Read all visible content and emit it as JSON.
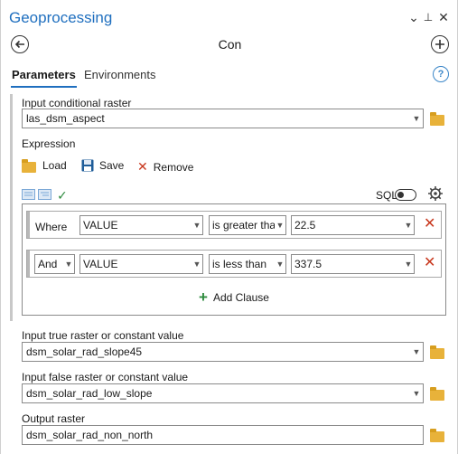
{
  "header": {
    "title": "Geoprocessing",
    "dropdown_glyph": "⌄",
    "pin_glyph": "⊥",
    "close_glyph": "✕",
    "tool_name": "Con"
  },
  "tabs": {
    "parameters": "Parameters",
    "environments": "Environments"
  },
  "help_glyph": "?",
  "params": {
    "input_conditional_raster": {
      "label": "Input conditional raster",
      "value": "las_dsm_aspect"
    },
    "expression_label": "Expression",
    "true_raster": {
      "label": "Input true raster or constant value",
      "value": "dsm_solar_rad_slope45"
    },
    "false_raster": {
      "label": "Input false raster or constant value",
      "value": "dsm_solar_rad_low_slope"
    },
    "output_raster": {
      "label": "Output raster",
      "value": "dsm_solar_rad_non_north"
    }
  },
  "expression_toolbar": {
    "load": "Load",
    "save": "Save",
    "remove": "Remove",
    "sql_label": "SQL"
  },
  "clauses": [
    {
      "connector": "Where",
      "field": "VALUE",
      "operator": "is greater tha",
      "value": "22.5"
    },
    {
      "connector": "And",
      "field": "VALUE",
      "operator": "is less than",
      "value": "337.5"
    }
  ],
  "add_clause": "Add Clause",
  "colors": {
    "accent": "#1f6fbf",
    "delete": "#c8371d",
    "add": "#2e8b3e",
    "folder": "#e8b23a"
  }
}
